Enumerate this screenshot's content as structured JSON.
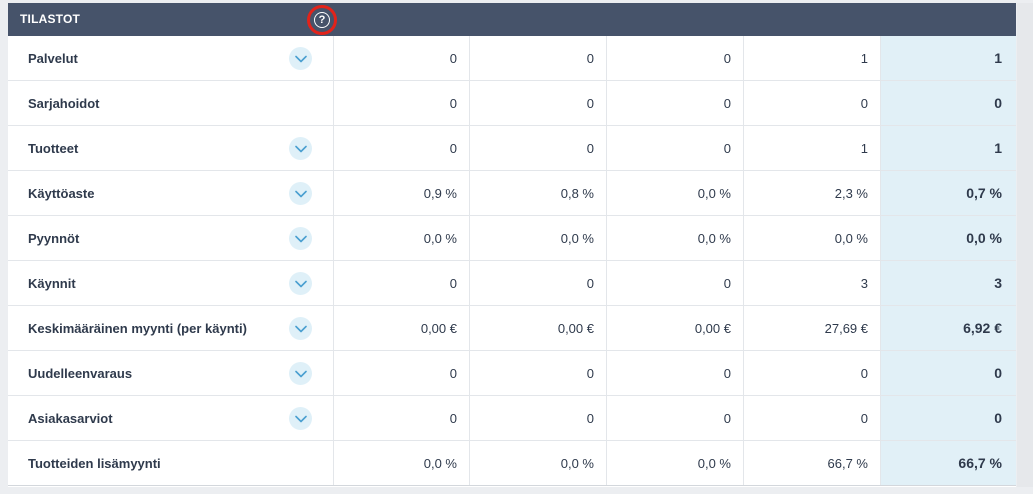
{
  "header": {
    "title": "TILASTOT",
    "help_icon": "question-circle-icon"
  },
  "colors": {
    "header_bg": "#46536a",
    "highlight": "#e1f0f7",
    "accent_circle": "#e2231a",
    "chevron_bg": "#dff0f8"
  },
  "rows": [
    {
      "label": "Palvelut",
      "expandable": true,
      "values": [
        "0",
        "0",
        "0",
        "1"
      ],
      "total": "1"
    },
    {
      "label": "Sarjahoidot",
      "expandable": false,
      "values": [
        "0",
        "0",
        "0",
        "0"
      ],
      "total": "0"
    },
    {
      "label": "Tuotteet",
      "expandable": true,
      "values": [
        "0",
        "0",
        "0",
        "1"
      ],
      "total": "1"
    },
    {
      "label": "Käyttöaste",
      "expandable": true,
      "values": [
        "0,9 %",
        "0,8 %",
        "0,0 %",
        "2,3 %"
      ],
      "total": "0,7 %"
    },
    {
      "label": "Pyynnöt",
      "expandable": true,
      "values": [
        "0,0 %",
        "0,0 %",
        "0,0 %",
        "0,0 %"
      ],
      "total": "0,0 %"
    },
    {
      "label": "Käynnit",
      "expandable": true,
      "values": [
        "0",
        "0",
        "0",
        "3"
      ],
      "total": "3"
    },
    {
      "label": "Keskimääräinen myynti (per käynti)",
      "expandable": true,
      "values": [
        "0,00 €",
        "0,00 €",
        "0,00 €",
        "27,69 €"
      ],
      "total": "6,92 €"
    },
    {
      "label": "Uudelleenvaraus",
      "expandable": true,
      "values": [
        "0",
        "0",
        "0",
        "0"
      ],
      "total": "0"
    },
    {
      "label": "Asiakasarviot",
      "expandable": true,
      "values": [
        "0",
        "0",
        "0",
        "0"
      ],
      "total": "0"
    },
    {
      "label": "Tuotteiden lisämyynti",
      "expandable": false,
      "values": [
        "0,0 %",
        "0,0 %",
        "0,0 %",
        "66,7 %"
      ],
      "total": "66,7 %"
    }
  ]
}
